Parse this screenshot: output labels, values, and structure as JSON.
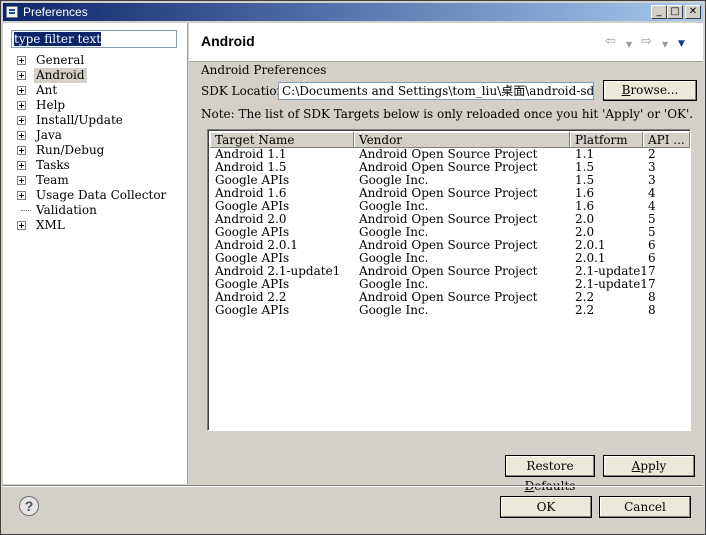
{
  "window": {
    "title": "Preferences"
  },
  "left": {
    "filter_text": "type filter text",
    "tree": [
      {
        "label": "General",
        "expandable": true
      },
      {
        "label": "Android",
        "expandable": true,
        "selected": true
      },
      {
        "label": "Ant",
        "expandable": true
      },
      {
        "label": "Help",
        "expandable": true
      },
      {
        "label": "Install/Update",
        "expandable": true
      },
      {
        "label": "Java",
        "expandable": true
      },
      {
        "label": "Run/Debug",
        "expandable": true
      },
      {
        "label": "Tasks",
        "expandable": true
      },
      {
        "label": "Team",
        "expandable": true
      },
      {
        "label": "Usage Data Collector",
        "expandable": true
      },
      {
        "label": "Validation",
        "expandable": false
      },
      {
        "label": "XML",
        "expandable": true
      }
    ]
  },
  "right": {
    "title": "Android",
    "nav": {
      "back_icon": "back-arrow-icon",
      "forward_icon": "forward-arrow-icon",
      "menu_icon": "view-menu-icon"
    },
    "section_label": "Android Preferences",
    "sdk_label": "SDK Location:",
    "sdk_path": "C:\\Documents and Settings\\tom_liu\\桌面\\android-sdk-windows",
    "browse_label": "Browse...",
    "note": "Note: The list of SDK Targets below is only reloaded once you hit 'Apply' or 'OK'.",
    "table": {
      "columns": [
        "Target Name",
        "Vendor",
        "Platform",
        "API ..."
      ],
      "rows": [
        [
          "Android 1.1",
          "Android Open Source Project",
          "1.1",
          "2"
        ],
        [
          "Android 1.5",
          "Android Open Source Project",
          "1.5",
          "3"
        ],
        [
          "Google APIs",
          "Google Inc.",
          "1.5",
          "3"
        ],
        [
          "Android 1.6",
          "Android Open Source Project",
          "1.6",
          "4"
        ],
        [
          "Google APIs",
          "Google Inc.",
          "1.6",
          "4"
        ],
        [
          "Android 2.0",
          "Android Open Source Project",
          "2.0",
          "5"
        ],
        [
          "Google APIs",
          "Google Inc.",
          "2.0",
          "5"
        ],
        [
          "Android 2.0.1",
          "Android Open Source Project",
          "2.0.1",
          "6"
        ],
        [
          "Google APIs",
          "Google Inc.",
          "2.0.1",
          "6"
        ],
        [
          "Android 2.1-update1",
          "Android Open Source Project",
          "2.1-update1",
          "7"
        ],
        [
          "Google APIs",
          "Google Inc.",
          "2.1-update1",
          "7"
        ],
        [
          "Android 2.2",
          "Android Open Source Project",
          "2.2",
          "8"
        ],
        [
          "Google APIs",
          "Google Inc.",
          "2.2",
          "8"
        ]
      ]
    },
    "restore_label": "Restore Defaults",
    "apply_label": "Apply"
  },
  "footer": {
    "ok_label": "OK",
    "cancel_label": "Cancel",
    "help_icon": "help-icon"
  },
  "colors": {
    "title_start": "#0a246a",
    "title_end": "#a6caf0",
    "dialog_bg": "#d4d0c8",
    "selection": "#0a246a"
  }
}
